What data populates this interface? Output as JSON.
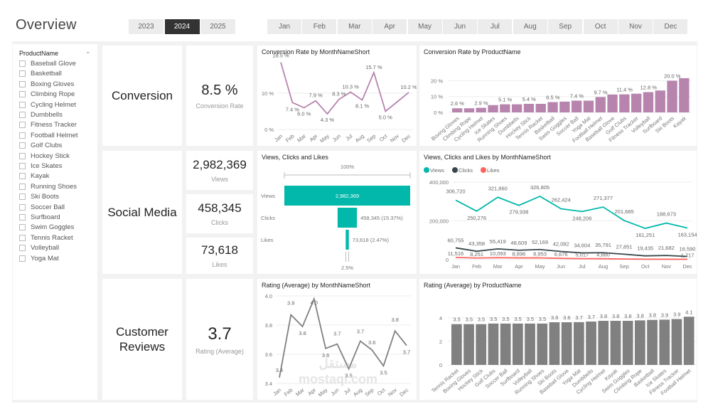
{
  "header": {
    "title": "Overview",
    "years": [
      "2023",
      "2024",
      "2025"
    ],
    "selected_year": "2024",
    "months": [
      "Jan",
      "Feb",
      "Mar",
      "Apr",
      "May",
      "Jun",
      "Jul",
      "Aug",
      "Sep",
      "Oct",
      "Nov",
      "Dec"
    ]
  },
  "slicer": {
    "title": "ProductName",
    "items": [
      "Baseball Glove",
      "Basketball",
      "Boxing Gloves",
      "Climbing Rope",
      "Cycling Helmet",
      "Dumbbells",
      "Fitness Tracker",
      "Football Helmet",
      "Golf Clubs",
      "Hockey Stick",
      "Ice Skates",
      "Kayak",
      "Running Shoes",
      "Ski Boots",
      "Soccer Ball",
      "Surfboard",
      "Swim Goggles",
      "Tennis Racket",
      "Volleyball",
      "Yoga Mat"
    ]
  },
  "sections": {
    "conversion": "Conversion",
    "social": "Social Media",
    "reviews": "Customer Reviews"
  },
  "kpis": {
    "conversion": {
      "value": "8.5 %",
      "caption": "Conversion Rate"
    },
    "views": {
      "value": "2,982,369",
      "caption": "Views"
    },
    "clicks": {
      "value": "458,345",
      "caption": "Clicks"
    },
    "likes": {
      "value": "73,618",
      "caption": "Likes"
    },
    "rating": {
      "value": "3.7",
      "caption": "Rating (Average)"
    }
  },
  "watermark": "مستقل mostaql.com",
  "colors": {
    "conversion": "#b784ae",
    "views": "#01b8aa",
    "clicks": "#374649",
    "likes": "#fd625e",
    "rating": "#808080",
    "selected": "#333333"
  },
  "chart_data": [
    {
      "id": "conv_month",
      "type": "line",
      "title": "Conversion Rate by MonthNameShort",
      "categories": [
        "Jan",
        "Feb",
        "Mar",
        "Apr",
        "May",
        "Jun",
        "Jul",
        "Aug",
        "Sep",
        "Oct",
        "Nov",
        "Dec"
      ],
      "values": [
        18.5,
        7.4,
        6.0,
        7.9,
        4.3,
        8.3,
        10.3,
        8.1,
        15.7,
        5.0,
        null,
        10.2
      ],
      "labels": [
        "18.5 %",
        "7.4 %",
        "6.0 %",
        "7.9 %",
        "4.3 %",
        "8.3 %",
        "10.3 %",
        "8.1 %",
        "15.7 %",
        "5.0 %",
        "",
        "10.2 %"
      ],
      "yticks": [
        "0 %",
        "10 %"
      ],
      "ylim": [
        0,
        20
      ],
      "unit": "%"
    },
    {
      "id": "conv_product",
      "type": "bar",
      "title": "Conversion Rate by ProductName",
      "categories": [
        "Boxing Gloves",
        "Climbing Rope",
        "Cycling Helmet",
        "Ice Skates",
        "Running Shoes",
        "Dumbbells",
        "Hockey Stick",
        "Tennis Racket",
        "Basketball",
        "Swim Goggles",
        "Soccer Ball",
        "Yoga Mat",
        "Football Helmet",
        "Baseball Glove",
        "Golf Clubs",
        "Fitness Tracker",
        "Volleyball",
        "Surfboard",
        "Ski Boots",
        "Kayak"
      ],
      "values": [
        2.6,
        2.6,
        2.9,
        4.6,
        5.1,
        5.1,
        5.4,
        5.4,
        6.5,
        6.8,
        7.4,
        7.4,
        9.7,
        11.3,
        11.4,
        11.8,
        12.8,
        13.8,
        20.0,
        21.6
      ],
      "labels": [
        "2.6 %",
        "",
        "2.9 %",
        "",
        "5.1 %",
        "",
        "5.4 %",
        "",
        "6.5 %",
        "",
        "7.4 %",
        "",
        "9.7 %",
        "",
        "11.4 %",
        "",
        "12.8 %",
        "",
        "20.0 %",
        ""
      ],
      "yticks": [
        "0 %",
        "10 %",
        "20 %"
      ],
      "ylim": [
        0,
        22
      ]
    },
    {
      "id": "funnel",
      "type": "funnel",
      "title": "Views, Clicks and Likes",
      "categories": [
        "Views",
        "Clicks",
        "Likes"
      ],
      "values": [
        2982369,
        458345,
        73618
      ],
      "labels": [
        "2,982,369",
        "458,345 (15.37%)",
        "73,618 (2.47%)"
      ],
      "top_pct": "100%",
      "bottom_pct": "2.5%"
    },
    {
      "id": "vcl_month",
      "type": "line",
      "title": "Views, Clicks and Likes by MonthNameShort",
      "categories": [
        "Jan",
        "Feb",
        "Mar",
        "Apr",
        "May",
        "Jun",
        "Jul",
        "Aug",
        "Sep",
        "Oct",
        "Nov",
        "Dec"
      ],
      "series": [
        {
          "name": "Views",
          "values": [
            306720,
            250276,
            321860,
            279938,
            326805,
            262424,
            248206,
            271377,
            201685,
            161251,
            188673,
            163154
          ],
          "labels": [
            "306,720",
            "250,276",
            "321,860",
            "279,938",
            "326,805",
            "262,424",
            "248,206",
            "271,377",
            "201,685",
            "161,251",
            "188,673",
            "163,154"
          ]
        },
        {
          "name": "Clicks",
          "values": [
            60755,
            43358,
            55419,
            48609,
            52169,
            42082,
            34604,
            35791,
            27851,
            19435,
            21682,
            16590
          ],
          "labels": [
            "60,755",
            "43,358",
            "55,419",
            "48,609",
            "52,169",
            "42,082",
            "34,604",
            "35,791",
            "27,851",
            "19,435",
            "21,682",
            "16,590"
          ]
        },
        {
          "name": "Likes",
          "values": [
            11516,
            8251,
            10093,
            8896,
            8953,
            6676,
            5017,
            4880,
            3200,
            2400,
            2000,
            1717
          ],
          "labels": [
            "11,516",
            "8,251",
            "10,093",
            "8,896",
            "8,953",
            "6,676",
            "5,017",
            "4,880",
            "",
            "",
            "",
            "1,717"
          ]
        }
      ],
      "yticks": [
        "0",
        "200,000",
        "400,000"
      ],
      "ylim": [
        0,
        400000
      ],
      "legend": "top-left"
    },
    {
      "id": "rating_month",
      "type": "line",
      "title": "Rating (Average) by MonthNameShort",
      "categories": [
        "Jan",
        "Feb",
        "Mar",
        "Apr",
        "May",
        "Jun",
        "Jul",
        "Aug",
        "Sep",
        "Oct",
        "Nov",
        "Dec"
      ],
      "values": [
        3.44,
        3.87,
        3.79,
        3.98,
        3.64,
        3.67,
        3.5,
        3.69,
        3.63,
        3.52,
        3.76,
        3.66
      ],
      "labels": [
        "3.4",
        "3.9",
        "3.8",
        "4.0",
        "3.6",
        "3.7",
        "3.5",
        "3.7",
        "3.6",
        "3.5",
        "3.8",
        "3.7"
      ],
      "yticks": [
        "3.4",
        "3.6",
        "3.8",
        "4.0"
      ],
      "ylim": [
        3.4,
        4.0
      ]
    },
    {
      "id": "rating_product",
      "type": "bar",
      "title": "Rating (Average) by ProductName",
      "categories": [
        "Tennis Racket",
        "Boxing Gloves",
        "Hockey Stick",
        "Golf Clubs",
        "Soccer Ball",
        "Surfboard",
        "Volleyball",
        "Running Shoes",
        "Ski Boots",
        "Baseball Glove",
        "Yoga Mat",
        "Dumbbells",
        "Cycling Helmet",
        "Kayak",
        "Swim Goggles",
        "Climbing Rope",
        "Basketball",
        "Ice Skates",
        "Fitness Tracker",
        "Football Helmet"
      ],
      "values": [
        3.47,
        3.47,
        3.47,
        3.52,
        3.52,
        3.52,
        3.52,
        3.52,
        3.63,
        3.63,
        3.64,
        3.69,
        3.75,
        3.75,
        3.75,
        3.79,
        3.83,
        3.85,
        3.9,
        4.1
      ],
      "labels": [
        "3.5",
        "3.5",
        "3.5",
        "3.5",
        "3.5",
        "3.5",
        "3.5",
        "3.5",
        "3.6",
        "3.6",
        "3.7",
        "3.7",
        "3.8",
        "3.8",
        "3.8",
        "3.8",
        "3.8",
        "3.9",
        "3.9",
        "4.1"
      ],
      "yticks": [
        "0",
        "2",
        "4"
      ],
      "ylim": [
        0,
        4.6
      ]
    }
  ]
}
